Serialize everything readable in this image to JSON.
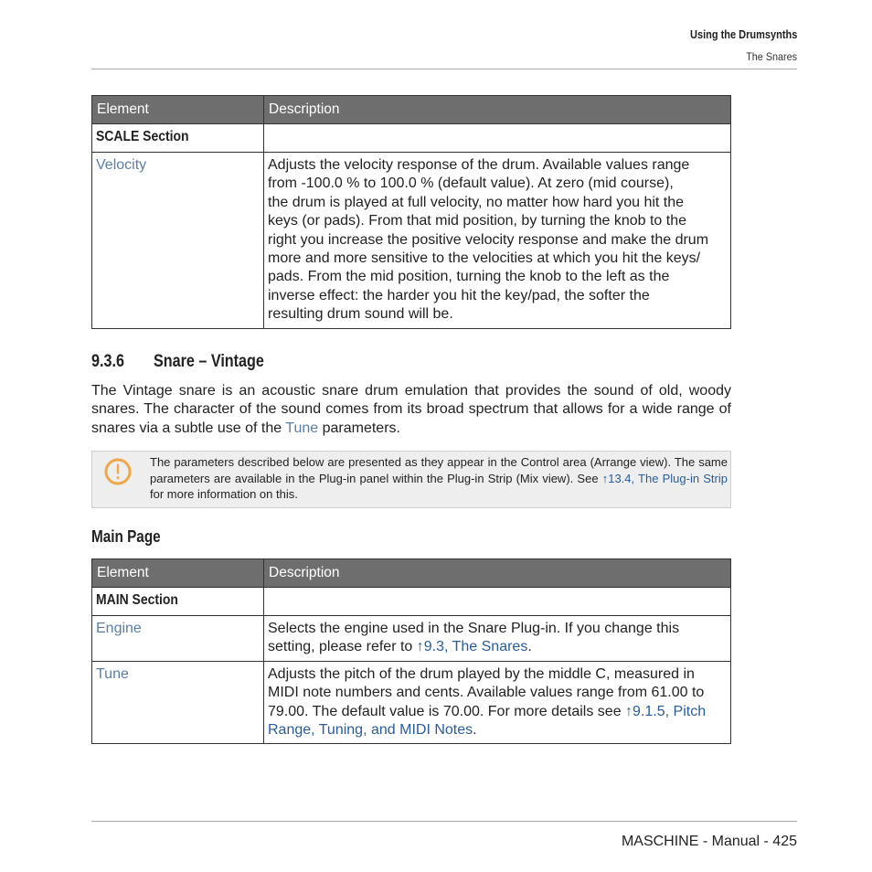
{
  "header": {
    "chapter": "Using the Drumsynths",
    "section": "The Snares"
  },
  "table1": {
    "headers": [
      "Element",
      "Description"
    ],
    "section_label": "SCALE Section",
    "rows": [
      {
        "element": "Velocity",
        "lines": [
          "Adjusts the velocity response of the drum. Available values range",
          "from -100.0 % to 100.0 % (default value). At zero (mid course),",
          "the drum is played at full velocity, no matter how hard you hit the",
          "keys (or pads). From that mid position, by turning the knob to the",
          "right you increase the positive velocity response and make the drum",
          "more and more sensitive to the velocities at which you hit the keys/",
          "pads. From the mid position, turning the knob to the left as the",
          "inverse effect: the harder you hit the key/pad, the softer the",
          "resulting drum sound will be."
        ]
      }
    ]
  },
  "section": {
    "number": "9.3.6",
    "title": "Snare – Vintage",
    "para_before": "The Vintage snare is an acoustic snare drum emulation that provides the sound of old, woody snares. The character of the sound comes from its broad spectrum that allows for a wide range of snares via a subtle use of the ",
    "para_link": "Tune",
    "para_after": " parameters."
  },
  "note": {
    "icon": "warning-icon",
    "icon_color": "#f0a64a",
    "text_before": "The parameters described below are presented as they appear in the Control area (Arrange view). The same parameters are available in the Plug-in panel within the Plug-in Strip (Mix view). See ",
    "link": "↑13.4, The Plug-in Strip",
    "text_after": " for more information on this."
  },
  "subheading": "Main Page",
  "table2": {
    "headers": [
      "Element",
      "Description"
    ],
    "section_label": "MAIN Section",
    "rows": [
      {
        "element": "Engine",
        "text_before": "Selects the engine used in the Snare Plug-in. If you change this setting, please refer to ",
        "link": "↑9.3, The Snares",
        "text_after": "."
      },
      {
        "element": "Tune",
        "text_before": "Adjusts the pitch of the drum played by the middle C, measured in MIDI note numbers and cents. Available values range from 61.00 to 79.00. The default value is 70.00. For more details see ",
        "link": "↑9.1.5, Pitch Range, Tuning, and MIDI Notes",
        "text_after": "."
      }
    ]
  },
  "footer": {
    "text": "MASCHINE - Manual - 425"
  },
  "colors": {
    "header_bg": "#6e6e6e",
    "element_link": "#5b7ea6",
    "xref_link": "#2a5d98",
    "note_bg": "#eeeeee"
  }
}
